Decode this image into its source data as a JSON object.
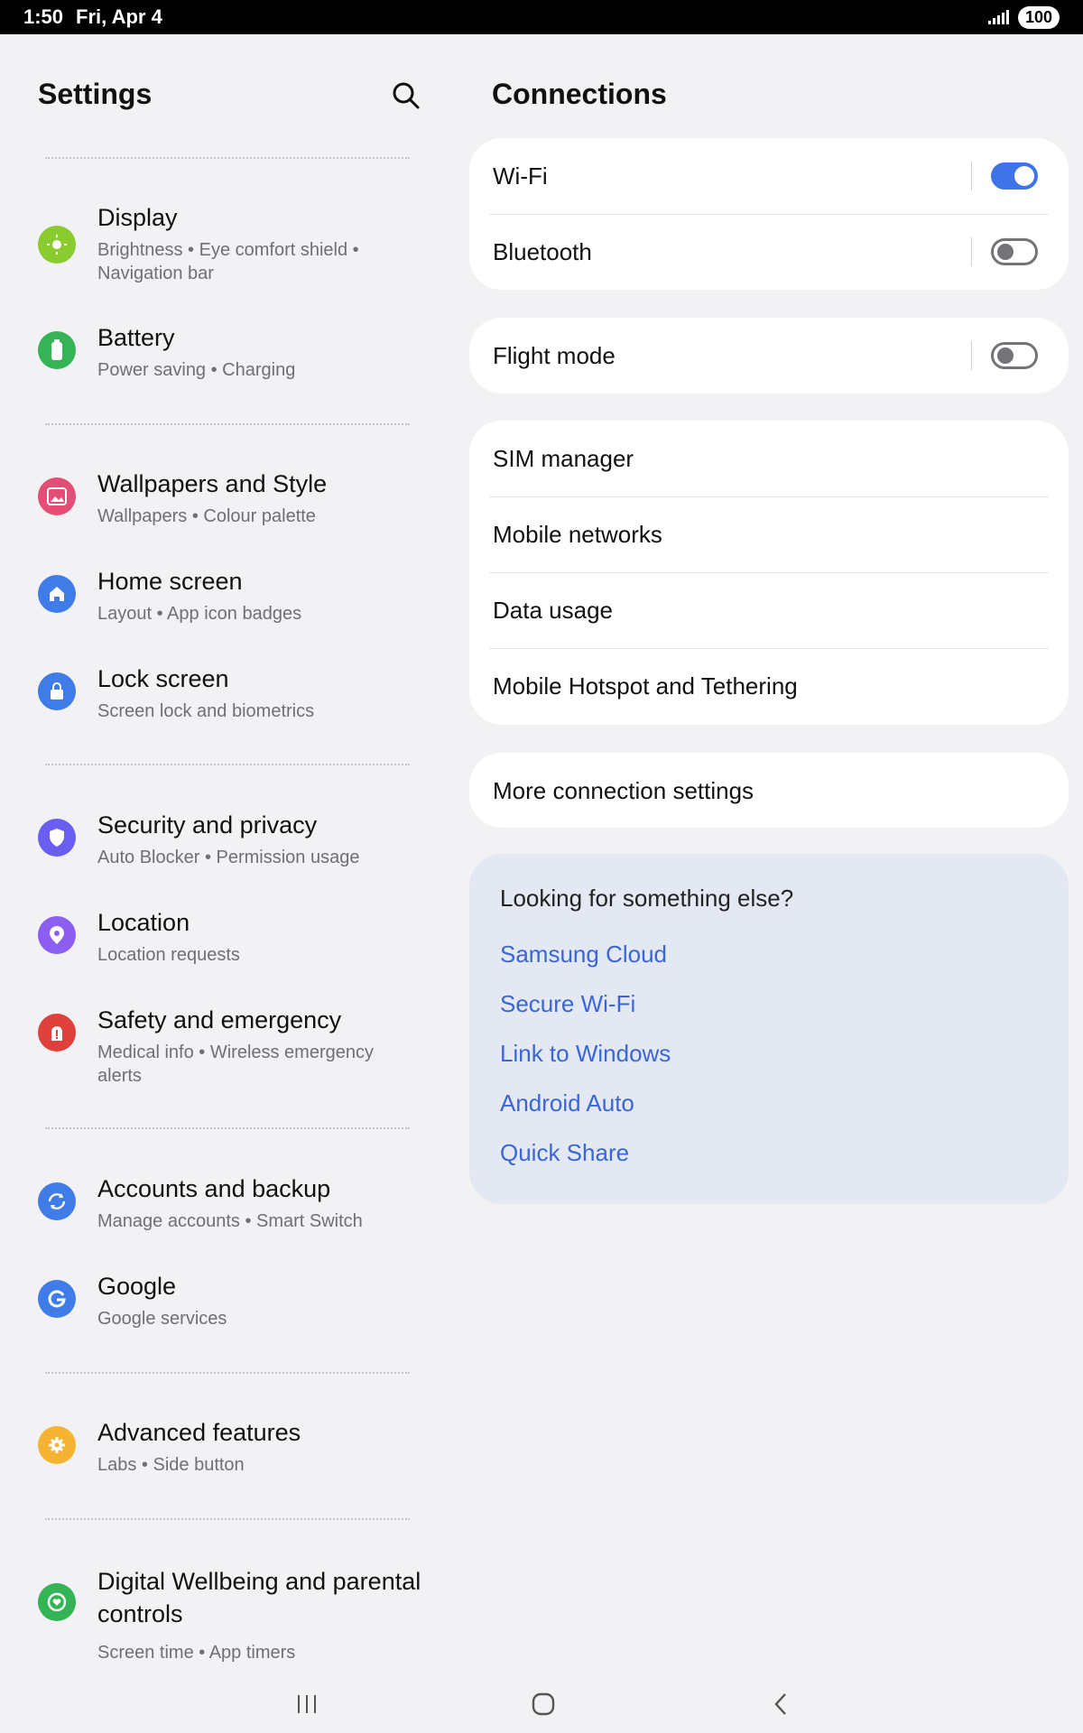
{
  "status_bar": {
    "time": "1:50",
    "date": "Fri, Apr 4",
    "battery": "100"
  },
  "left_panel": {
    "title": "Settings",
    "items": [
      {
        "title": "Display",
        "subtitle": "Brightness  •  Eye comfort shield  •  Navigation bar",
        "color": "#8acb2f"
      },
      {
        "title": "Battery",
        "subtitle": "Power saving  •  Charging",
        "color": "#34b454"
      },
      {
        "title": "Wallpapers and Style",
        "subtitle": "Wallpapers  •  Colour palette",
        "color": "#e64d74"
      },
      {
        "title": "Home screen",
        "subtitle": "Layout  •  App icon badges",
        "color": "#3f7ce8"
      },
      {
        "title": "Lock screen",
        "subtitle": "Screen lock and biometrics",
        "color": "#3f7ce8"
      },
      {
        "title": "Security and privacy",
        "subtitle": "Auto Blocker  •  Permission usage",
        "color": "#6a5ef0"
      },
      {
        "title": "Location",
        "subtitle": "Location requests",
        "color": "#8d5ef2"
      },
      {
        "title": "Safety and emergency",
        "subtitle": "Medical info  •  Wireless emergency alerts",
        "color": "#e0403b"
      },
      {
        "title": "Accounts and backup",
        "subtitle": "Manage accounts  •  Smart Switch",
        "color": "#3f7ce8"
      },
      {
        "title": "Google",
        "subtitle": "Google services",
        "color": "#3f7ce8"
      },
      {
        "title": "Advanced features",
        "subtitle": "Labs  •  Side button",
        "color": "#f6b332"
      },
      {
        "title": "Digital Wellbeing and parental controls",
        "subtitle": "Screen time  •  App timers",
        "color": "#34b454"
      }
    ]
  },
  "right_panel": {
    "title": "Connections",
    "wifi": {
      "label": "Wi-Fi",
      "on": true
    },
    "bluetooth": {
      "label": "Bluetooth",
      "on": false
    },
    "flight_mode": {
      "label": "Flight mode",
      "on": false
    },
    "sim_manager": "SIM manager",
    "mobile_networks": "Mobile networks",
    "data_usage": "Data usage",
    "hotspot": "Mobile Hotspot and Tethering",
    "more_settings": "More connection settings",
    "suggestions": {
      "heading": "Looking for something else?",
      "links": [
        "Samsung Cloud",
        "Secure Wi-Fi",
        "Link to Windows",
        "Android Auto",
        "Quick Share"
      ]
    }
  },
  "accent_color": "#3e74e8"
}
